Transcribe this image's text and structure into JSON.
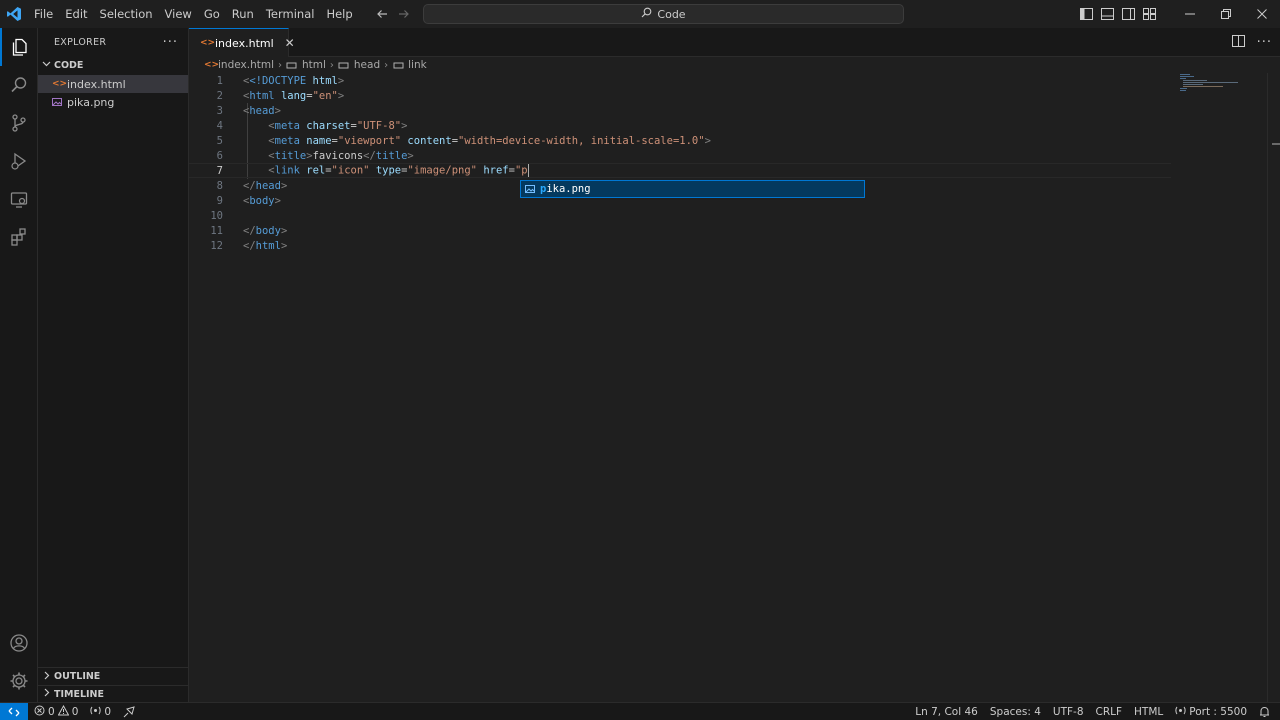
{
  "menu": [
    "File",
    "Edit",
    "Selection",
    "View",
    "Go",
    "Run",
    "Terminal",
    "Help"
  ],
  "command_center": {
    "label": "Code"
  },
  "sidebar": {
    "title": "EXPLORER",
    "folder": "CODE",
    "files": [
      {
        "name": "index.html",
        "icon": "html-file-icon",
        "selected": true
      },
      {
        "name": "pika.png",
        "icon": "image-file-icon",
        "selected": false
      }
    ],
    "outline": "OUTLINE",
    "timeline": "TIMELINE"
  },
  "tab": {
    "label": "index.html",
    "icon_text": "<>"
  },
  "breadcrumb": [
    "index.html",
    "html",
    "head",
    "link"
  ],
  "editor": {
    "line_numbers": [
      "1",
      "2",
      "3",
      "4",
      "5",
      "6",
      "7",
      "8",
      "9",
      "10",
      "11",
      "12"
    ],
    "active_line": "7",
    "lines": {
      "l1_a": "<!DOCTYPE",
      "l1_b": " html",
      "l1_c": ">",
      "l2_tag": "html",
      "l2_attr": "lang",
      "l2_val": "\"en\"",
      "l3_tag": "head",
      "l4_tag": "meta",
      "l4_attr": "charset",
      "l4_val": "\"UTF-8\"",
      "l5_tag": "meta",
      "l5_attr1": "name",
      "l5_val1": "\"viewport\"",
      "l5_attr2": "content",
      "l5_val2": "\"width=device-width, initial-scale=1.0\"",
      "l6_tag": "title",
      "l6_text": "favicons",
      "l7_tag": "link",
      "l7_attr1": "rel",
      "l7_val1": "\"icon\"",
      "l7_attr2": "type",
      "l7_val2": "\"image/png\"",
      "l7_attr3": "href",
      "l7_val3": "\"p",
      "l8_tag": "head",
      "l9_tag": "body",
      "l11_tag": "body",
      "l12_tag": "html"
    },
    "suggestion": {
      "match": "p",
      "rest": "ika.png"
    }
  },
  "status": {
    "errors": "0",
    "warnings": "0",
    "ports": "0",
    "position": "Ln 7, Col 46",
    "spaces": "Spaces: 4",
    "encoding": "UTF-8",
    "eol": "CRLF",
    "language": "HTML",
    "port": "Port : 5500"
  },
  "colors": {
    "accent": "#0078d4",
    "tag": "#569cd6",
    "attr": "#9cdcfe",
    "string": "#ce9178",
    "html_icon": "#e37933"
  }
}
